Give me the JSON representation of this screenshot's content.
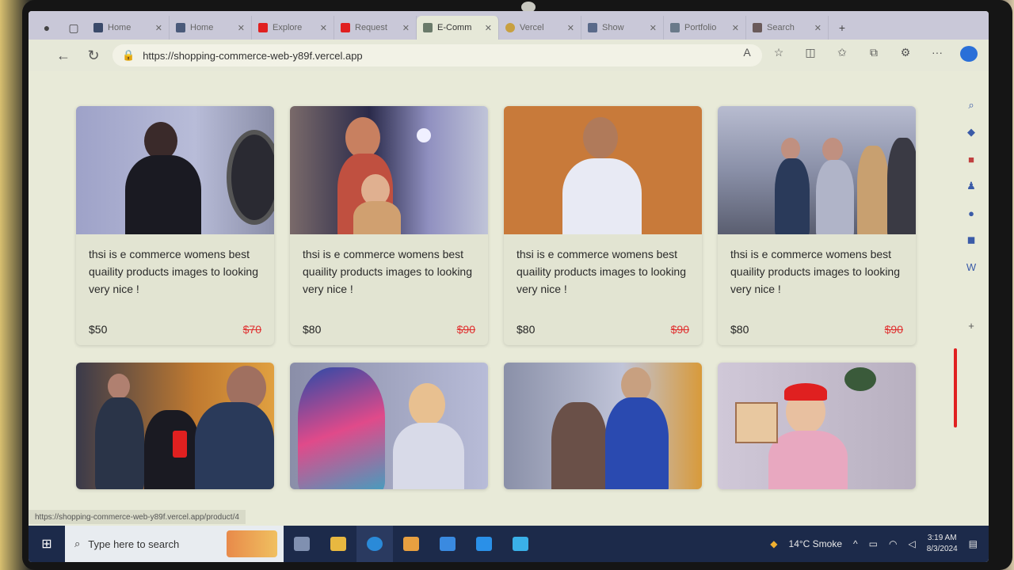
{
  "browser": {
    "tabs": [
      {
        "label": "Home",
        "color": "#3a4a6a"
      },
      {
        "label": "Home",
        "color": "#4a5a7a"
      },
      {
        "label": "Explore",
        "color": "#e02020"
      },
      {
        "label": "Request",
        "color": "#e02020"
      },
      {
        "label": "E-Comm",
        "color": "#6a7a6a",
        "active": true
      },
      {
        "label": "Vercel",
        "color": "#c8a040"
      },
      {
        "label": "Show",
        "color": "#5a6a8a"
      },
      {
        "label": "Portfolio",
        "color": "#6a7a8a"
      },
      {
        "label": "Search",
        "color": "#6a5a5a"
      }
    ],
    "url": "https://shopping-commerce-web-y89f.vercel.app",
    "status_url": "https://shopping-commerce-web-y89f.vercel.app/product/4"
  },
  "products": [
    {
      "desc": "thsi is e commerce womens best quaility products images to looking very nice !",
      "price": "$50",
      "old_price": "$70"
    },
    {
      "desc": "thsi is e commerce womens best quaility products images to looking very nice !",
      "price": "$80",
      "old_price": "$90"
    },
    {
      "desc": "thsi is e commerce womens best quaility products images to looking very nice !",
      "price": "$80",
      "old_price": "$90"
    },
    {
      "desc": "thsi is e commerce womens best quaility products images to looking very nice !",
      "price": "$80",
      "old_price": "$90"
    }
  ],
  "taskbar": {
    "search_placeholder": "Type here to search",
    "weather": "14°C Smoke",
    "time": "3:19 AM",
    "date": "8/3/2024"
  },
  "colors": {
    "accent": "#e02020",
    "taskbar": "#1c2a4a"
  }
}
